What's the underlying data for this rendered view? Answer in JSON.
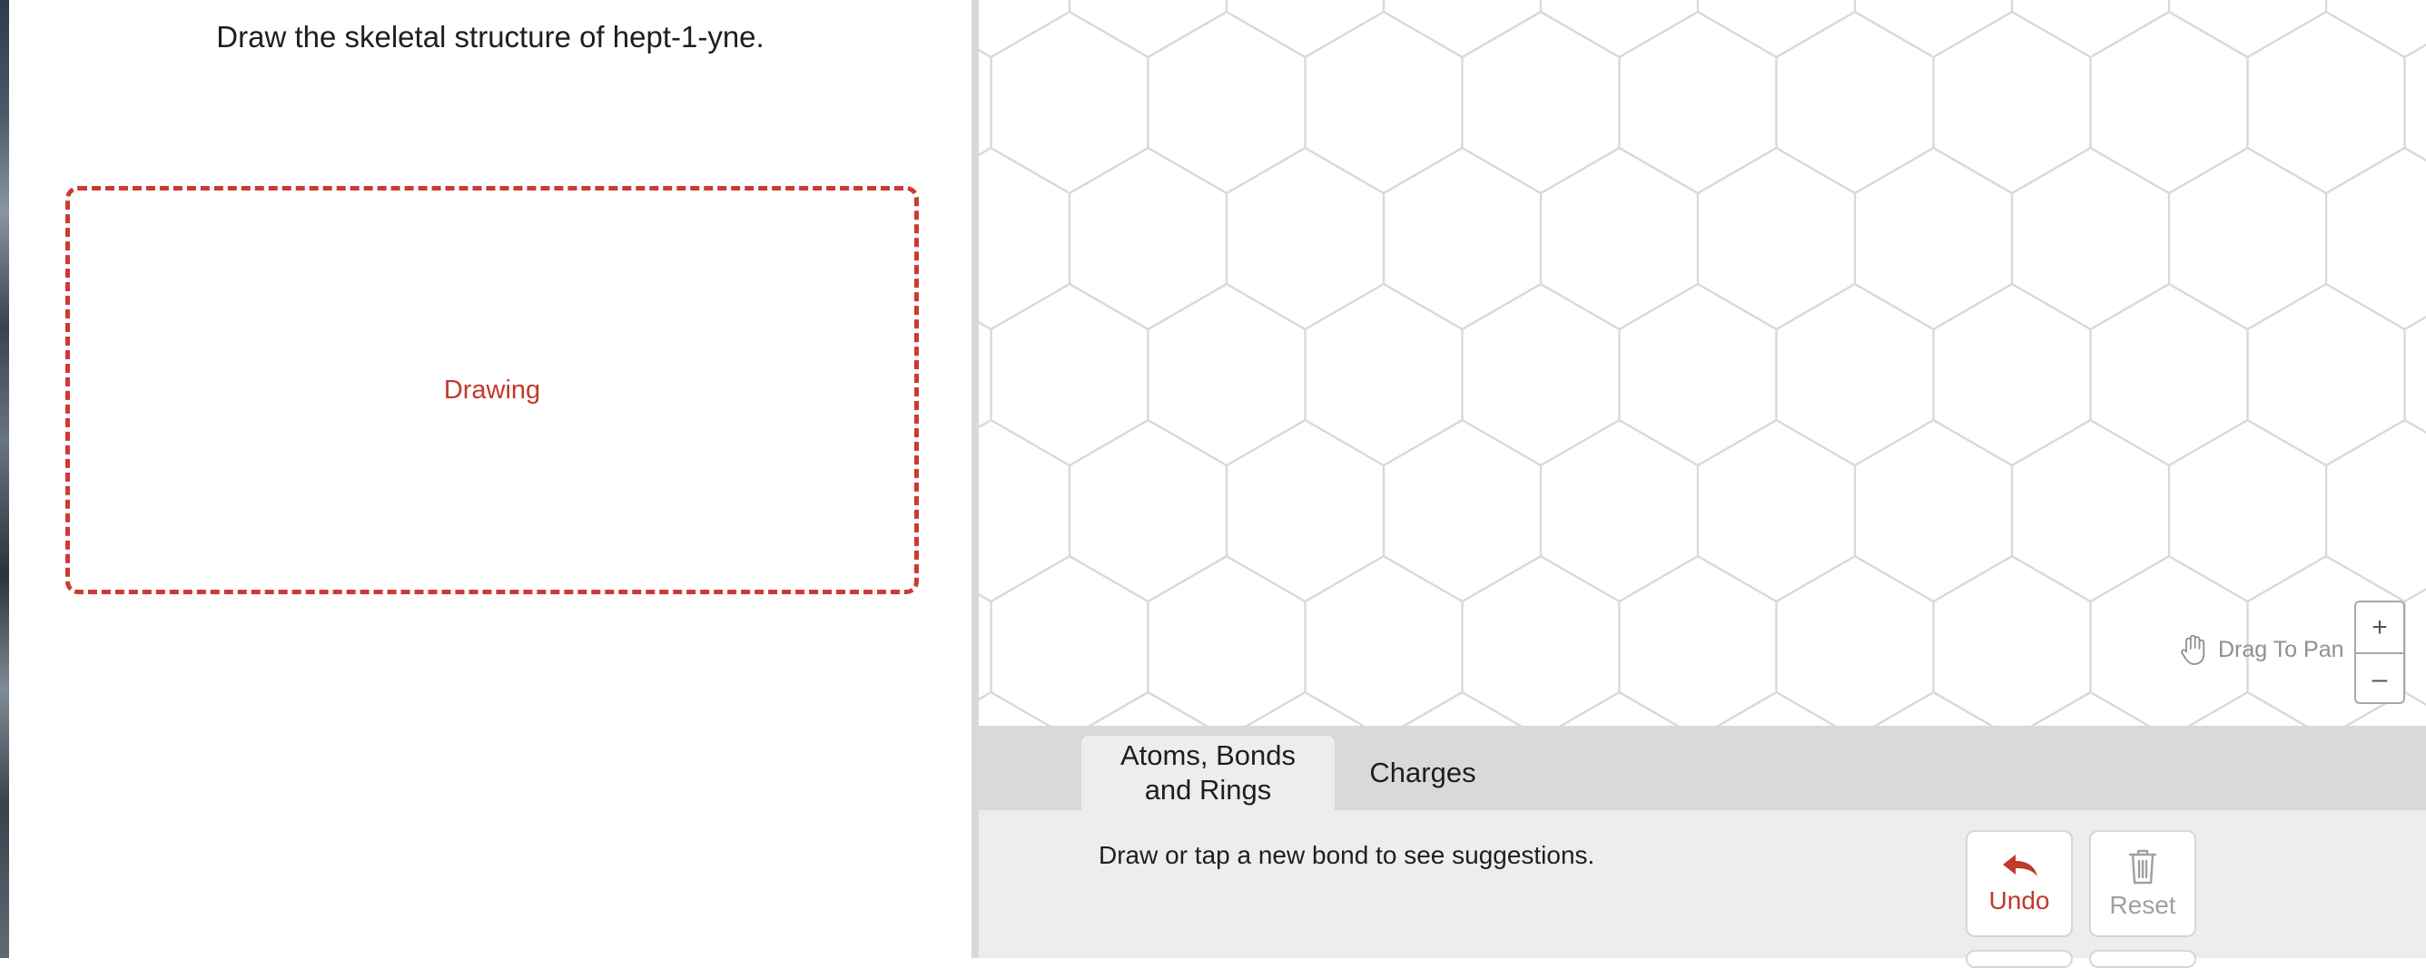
{
  "question": {
    "text": "Draw the skeletal structure of hept-1-yne."
  },
  "drawing_box": {
    "label": "Drawing"
  },
  "canvas": {
    "pan_hint": "Drag To Pan",
    "zoom_in": "+",
    "zoom_out": "–"
  },
  "tabs": [
    {
      "label_line1": "Atoms, Bonds",
      "label_line2": "and Rings",
      "active": true
    },
    {
      "label": "Charges",
      "active": false
    }
  ],
  "suggestion": "Draw or tap a new bond to see suggestions.",
  "buttons": {
    "undo": "Undo",
    "reset": "Reset"
  },
  "icons": {
    "undo": "undo-arrow-icon",
    "reset": "trash-icon",
    "pan": "hand-icon"
  },
  "colors": {
    "accent": "#c0392b",
    "grid_line": "#d9d9d9",
    "toolbar_bg": "#ededed",
    "tab_strip_bg": "#d9d9d9"
  }
}
